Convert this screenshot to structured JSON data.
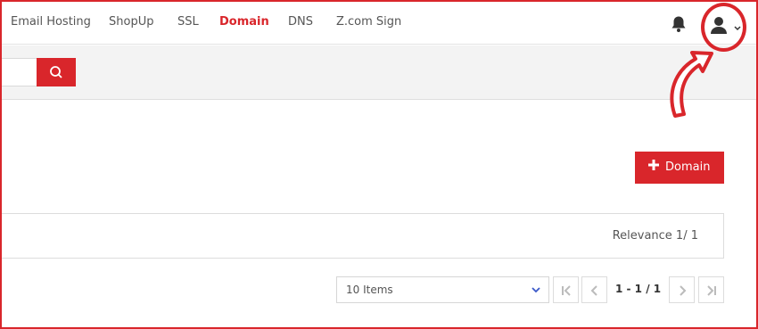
{
  "nav": {
    "items": [
      {
        "label": "Email Hosting"
      },
      {
        "label": "ShopUp"
      },
      {
        "label": "SSL"
      },
      {
        "label": "Domain",
        "active": true
      },
      {
        "label": "DNS"
      },
      {
        "label": "Z.com Sign"
      }
    ],
    "icons": [
      "bell-icon",
      "user-icon",
      "chevron-down-icon"
    ]
  },
  "search": {
    "placeholder": "",
    "button_icon": "search-icon"
  },
  "actions": {
    "add_domain_label": "Domain",
    "add_icon": "plus-icon"
  },
  "results": {
    "relevance_label": "Relevance 1/ 1"
  },
  "pagination": {
    "page_size_selected": "10 Items",
    "range_label": "1 - 1 / 1"
  },
  "colors": {
    "accent": "#d9262b",
    "annotation": "#d9262b"
  }
}
